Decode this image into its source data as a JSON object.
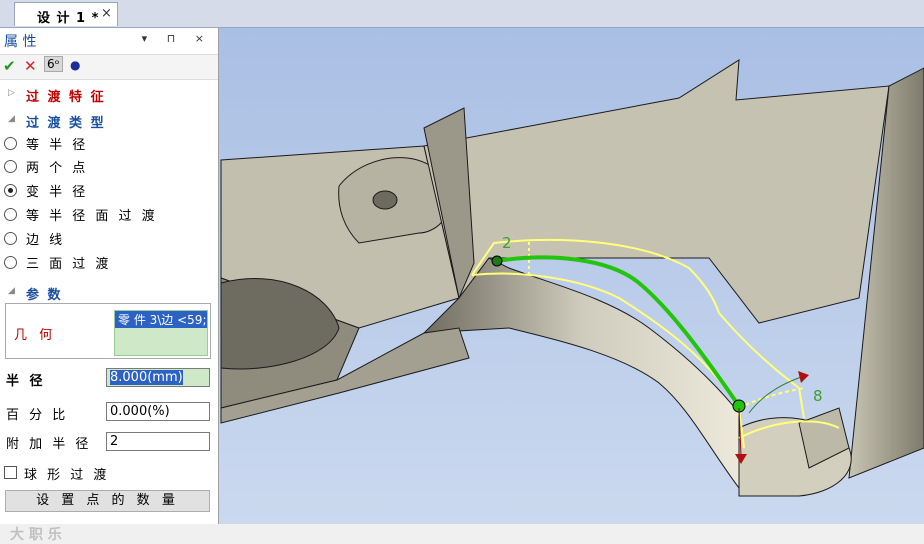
{
  "document_tab": {
    "title": "设 计 1 *",
    "close": "×"
  },
  "panel": {
    "title": "属 性",
    "controls": "▾ ⊓ ×",
    "toolbar": {
      "ok": "✔",
      "cancel": "✕",
      "preview": "6ᵒ",
      "dot": "●"
    },
    "sections": {
      "transition_feature": "过 渡 特 征",
      "transition_type": "过 渡 类 型",
      "parameters": "参 数"
    },
    "radio_options": [
      {
        "label": "等 半 径",
        "selected": false
      },
      {
        "label": "两 个 点",
        "selected": false
      },
      {
        "label": "变 半 径",
        "selected": true
      },
      {
        "label": "等 半 径 面 过 渡",
        "selected": false
      },
      {
        "label": "边 线",
        "selected": false
      },
      {
        "label": "三 面 过 渡",
        "selected": false
      }
    ],
    "geometry": {
      "label": "几 何",
      "item": "零 件 3\\边 <59;"
    },
    "fields": {
      "radius_label": "半 径",
      "radius_value": "8.000(mm)",
      "percent_label": "百 分 比",
      "percent_value": "0.000(%)",
      "extra_radius_label": "附 加 半 径",
      "extra_radius_value": "2"
    },
    "spherical_label": "球 形 过 渡",
    "set_points_button": "设 置 点 的 数 量",
    "watermark": "大 职 乐 "
  },
  "viewport": {
    "label_start": "2",
    "label_end": "8",
    "colors": {
      "background": "#b6c9e8",
      "solid": "#c9c6b8",
      "edge": "#1a1a1a",
      "highlight": "#ffff7a",
      "selected_edge": "#22c40c"
    }
  }
}
